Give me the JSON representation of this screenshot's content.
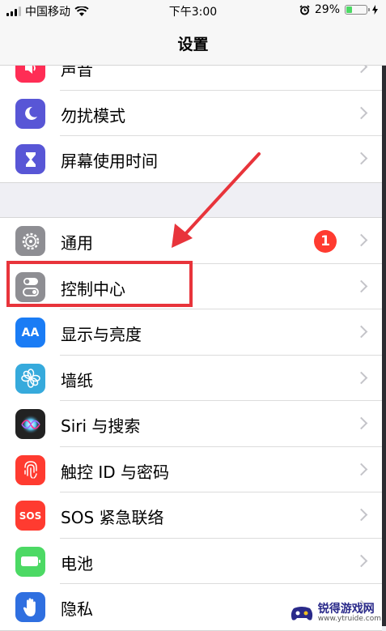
{
  "status_bar": {
    "carrier": "中国移动",
    "time": "下午3:00",
    "battery_percent": "29%",
    "battery_level": 0.29,
    "battery_color": "#4cd964"
  },
  "nav": {
    "title": "设置"
  },
  "groups": [
    {
      "items": [
        {
          "label": "声音",
          "icon": "sound-icon",
          "color": "#ff2d55"
        },
        {
          "label": "勿扰模式",
          "icon": "moon-icon",
          "color": "#5856d6"
        },
        {
          "label": "屏幕使用时间",
          "icon": "hourglass-icon",
          "color": "#5856d6"
        }
      ]
    },
    {
      "items": [
        {
          "label": "通用",
          "icon": "gear-icon",
          "color": "#8e8e93",
          "badge": "1"
        },
        {
          "label": "控制中心",
          "icon": "toggle-icon",
          "color": "#8e8e93"
        },
        {
          "label": "显示与亮度",
          "icon": "aa-icon",
          "color": "#1a7cf5",
          "icon_text": "AA"
        },
        {
          "label": "墙纸",
          "icon": "flower-icon",
          "color": "#36aadc"
        },
        {
          "label": "Siri 与搜索",
          "icon": "siri-icon",
          "color": "#222222"
        },
        {
          "label": "触控 ID 与密码",
          "icon": "fingerprint-icon",
          "color": "#ff3b30"
        },
        {
          "label": "SOS 紧急联络",
          "icon": "sos-icon",
          "color": "#ff3b30",
          "icon_text": "SOS"
        },
        {
          "label": "电池",
          "icon": "battery-icon",
          "color": "#4cd964"
        },
        {
          "label": "隐私",
          "icon": "hand-icon",
          "color": "#2f6fe0"
        }
      ]
    }
  ],
  "annotation": {
    "highlight_color": "#e8343b"
  },
  "watermark": {
    "name": "锐得游戏网",
    "url": "www.ytruide.com"
  }
}
